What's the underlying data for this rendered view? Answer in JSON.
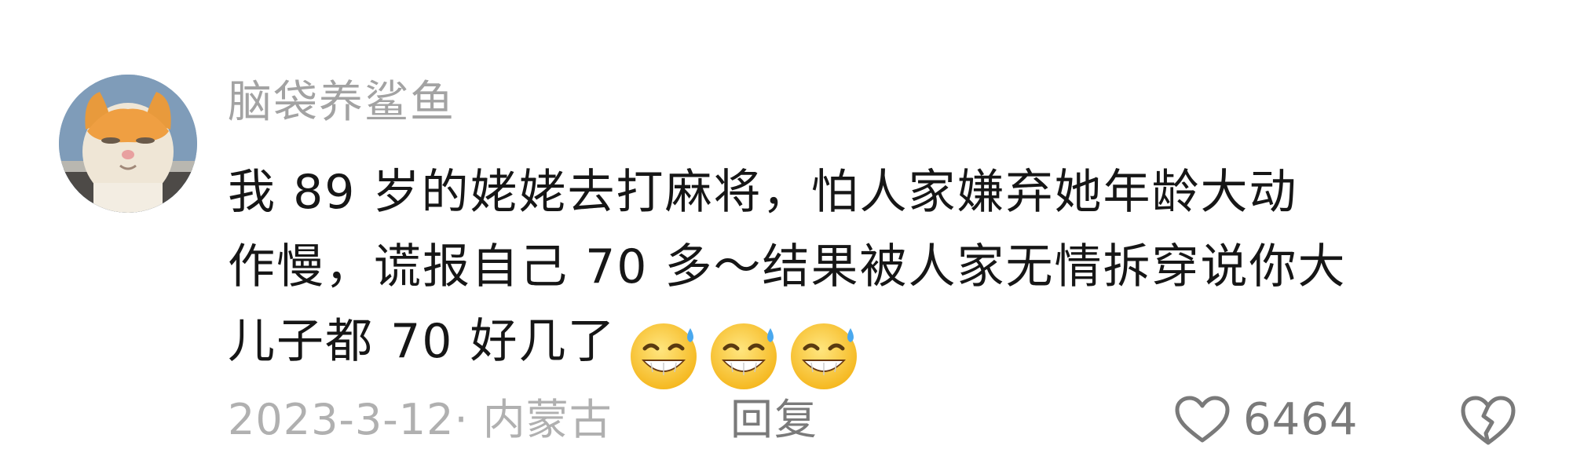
{
  "comment": {
    "username": "脑袋养鲨鱼",
    "text_lines": [
      "我 89 岁的姥姥去打麻将，怕人家嫌弃她年龄大动",
      "作慢，谎报自己 70 多～结果被人家无情拆穿说你大",
      "儿子都 70 好几了"
    ],
    "emojis": [
      "grin-sweat-icon",
      "grin-sweat-icon",
      "grin-sweat-icon"
    ],
    "meta": "2023-3-12· 内蒙古",
    "reply_label": "回复",
    "like_count": "6464",
    "colors": {
      "username": "#a3a3a3",
      "text": "#161616",
      "meta": "#b0b0b0",
      "action": "#7a7a7a"
    }
  }
}
